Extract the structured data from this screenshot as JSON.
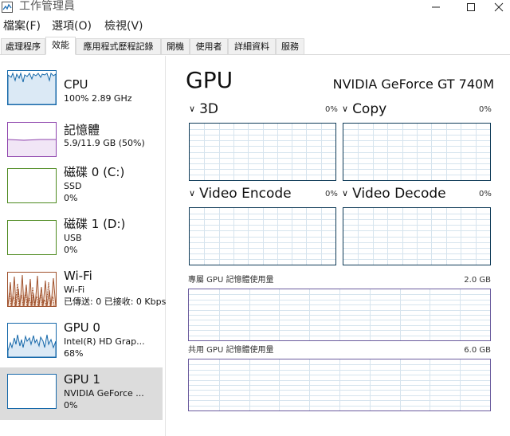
{
  "window": {
    "title": "工作管理員",
    "minimize_glyph": "—",
    "maximize_glyph": "☐",
    "close_glyph": "✕"
  },
  "menu": [
    "檔案(F)",
    "選項(O)",
    "檢視(V)"
  ],
  "tabs": [
    "處理程序",
    "效能",
    "應用程式歷程記錄",
    "開機",
    "使用者",
    "詳細資料",
    "服務"
  ],
  "active_tab": "效能",
  "sidebar": {
    "items": [
      {
        "name": "CPU",
        "sub1": "100%  2.89 GHz",
        "sub2": "",
        "color": "#1769aa"
      },
      {
        "name": "記憶體",
        "sub1": "5.9/11.9 GB (50%)",
        "sub2": "",
        "color": "#8e44ad"
      },
      {
        "name": "磁碟 0 (C:)",
        "sub1": "SSD",
        "sub2": "0%",
        "color": "#4d8a1f"
      },
      {
        "name": "磁碟 1 (D:)",
        "sub1": "USB",
        "sub2": "0%",
        "color": "#4d8a1f"
      },
      {
        "name": "Wi-Fi",
        "sub1": "Wi-Fi",
        "sub2": "已傳送: 0 已接收: 0 Kbps",
        "color": "#a0522d"
      },
      {
        "name": "GPU 0",
        "sub1": "Intel(R) HD Grap...",
        "sub2": "68%",
        "color": "#1769aa"
      },
      {
        "name": "GPU 1",
        "sub1": "NVIDIA GeForce ...",
        "sub2": "0%",
        "color": "#1769aa"
      }
    ]
  },
  "main": {
    "title": "GPU",
    "model": "NVIDIA GeForce GT 740M",
    "engines": [
      {
        "label": "3D",
        "pct": "0%"
      },
      {
        "label": "Copy",
        "pct": "0%"
      },
      {
        "label": "Video Encode",
        "pct": "0%"
      },
      {
        "label": "Video Decode",
        "pct": "0%"
      }
    ],
    "dedicated": {
      "label": "專屬 GPU 記憶體使用量",
      "max": "2.0 GB"
    },
    "shared": {
      "label": "共用 GPU 記憶體使用量",
      "max": "6.0 GB"
    }
  },
  "icons": [
    "task-manager-icon",
    "chevron-down-icon"
  ],
  "colors": {
    "graph_border": "#0f3b58",
    "grid": "#d6e4ee",
    "mem_border": "#6b5c9e",
    "selected_bg": "#dcdcdc"
  }
}
